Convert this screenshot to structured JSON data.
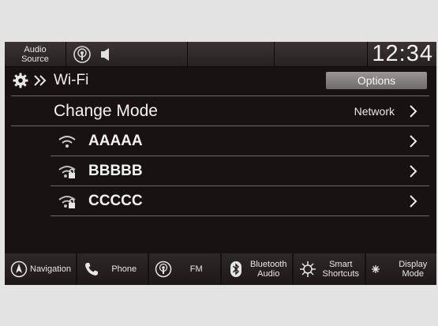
{
  "status_bar": {
    "audio_source_line1": "Audio",
    "audio_source_line2": "Source",
    "clock": "12:34"
  },
  "header": {
    "title": "Wi-Fi",
    "options_label": "Options"
  },
  "change_mode": {
    "label": "Change Mode",
    "value": "Network"
  },
  "networks": [
    {
      "name": "AAAAA",
      "icon": "wifi-icon"
    },
    {
      "name": "BBBBB",
      "icon": "wifi-lock-icon"
    },
    {
      "name": "CCCCC",
      "icon": "wifi-lock-icon"
    }
  ],
  "bottom_bar": {
    "navigation": "Navigation",
    "phone": "Phone",
    "fm": "FM",
    "bluetooth_line1": "Bluetooth",
    "bluetooth_line2": "Audio",
    "smart_line1": "Smart",
    "smart_line2": "Shortcuts",
    "display_line1": "Display",
    "display_line2": "Mode"
  },
  "colors": {
    "screen_bg": "#181212",
    "divider": "#6f6868",
    "options_button": "#8a8686"
  }
}
